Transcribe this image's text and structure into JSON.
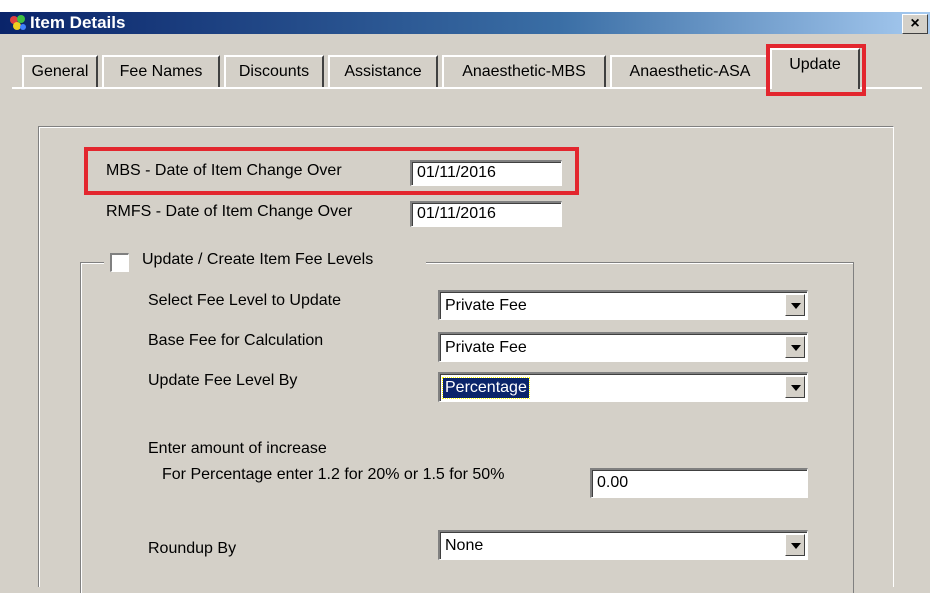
{
  "window": {
    "title": "Item Details",
    "close_label": "×"
  },
  "tabs": [
    {
      "label": "General"
    },
    {
      "label": "Fee Names"
    },
    {
      "label": "Discounts"
    },
    {
      "label": "Assistance"
    },
    {
      "label": "Anaesthetic-MBS"
    },
    {
      "label": "Anaesthetic-ASA"
    },
    {
      "label": "Update",
      "active": true
    }
  ],
  "update": {
    "mbs_date_label": "MBS - Date of Item Change Over",
    "mbs_date_value": "01/11/2016",
    "rmfs_date_label": "RMFS - Date of Item Change Over",
    "rmfs_date_value": "01/11/2016",
    "fee_group_label": "Update / Create Item Fee Levels",
    "fee_group_checked": false,
    "select_fee_level_label": "Select Fee Level to Update",
    "select_fee_level_value": "Private Fee",
    "base_fee_label": "Base Fee for Calculation",
    "base_fee_value": "Private Fee",
    "update_by_label": "Update Fee Level By",
    "update_by_value": "Percentage",
    "increase_heading": "Enter amount of increase",
    "increase_hint": "For Percentage enter 1.2 for 20% or 1.5 for 50%",
    "increase_value": "0.00",
    "roundup_label": "Roundup By",
    "roundup_value": "None"
  },
  "colors": {
    "highlight": "#e3262e",
    "titlebar": "#0a246a",
    "face": "#d4d0c8"
  }
}
